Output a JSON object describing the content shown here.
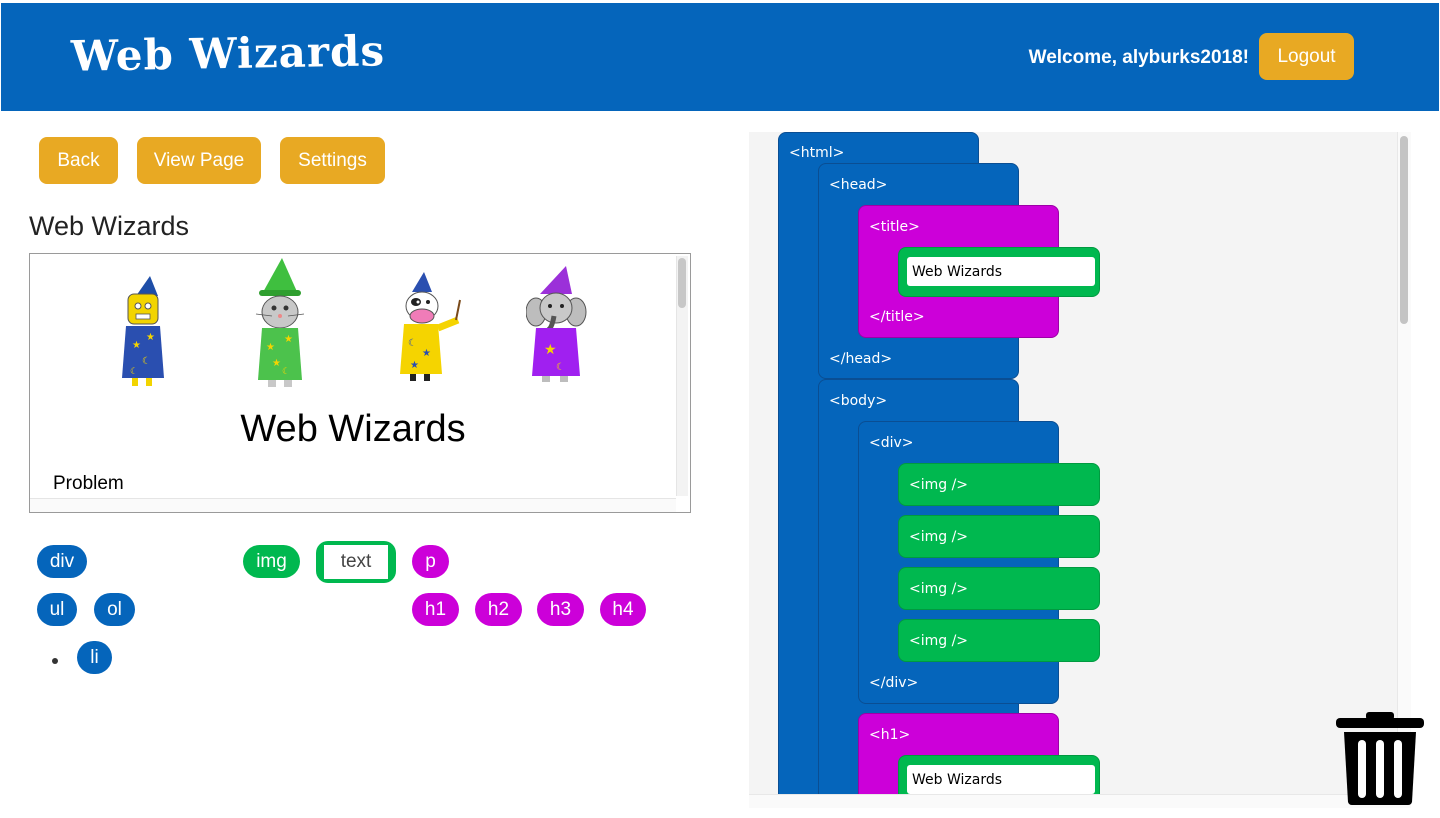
{
  "header": {
    "logo": "Web Wizards",
    "welcome": "Welcome, alyburks2018!",
    "logout_label": "Logout"
  },
  "nav": {
    "back_label": "Back",
    "view_page_label": "View Page",
    "settings_label": "Settings"
  },
  "page": {
    "title": "Web Wizards"
  },
  "preview": {
    "heading": "Web Wizards",
    "text": "Problem"
  },
  "palette": {
    "div": "div",
    "img": "img",
    "text": "text",
    "p": "p",
    "ul": "ul",
    "ol": "ol",
    "h1": "h1",
    "h2": "h2",
    "h3": "h3",
    "h4": "h4",
    "li": "li"
  },
  "workspace": {
    "html_open": "<html>",
    "head_open": "<head>",
    "title_open": "<title>",
    "title_value": "Web Wizards",
    "title_close": "</title>",
    "head_close": "</head>",
    "body_open": "<body>",
    "div_open": "<div>",
    "img1": "<img />",
    "img2": "<img />",
    "img3": "<img />",
    "img4": "<img />",
    "div_close": "</div>",
    "h1_open": "<h1>",
    "h1_value": "Web Wizards"
  },
  "colors": {
    "header_blue": "#0565bb",
    "button_orange": "#e8a923",
    "block_green": "#00b84f",
    "block_magenta": "#cc00d9"
  },
  "icons": {
    "trash": "trash-icon"
  }
}
